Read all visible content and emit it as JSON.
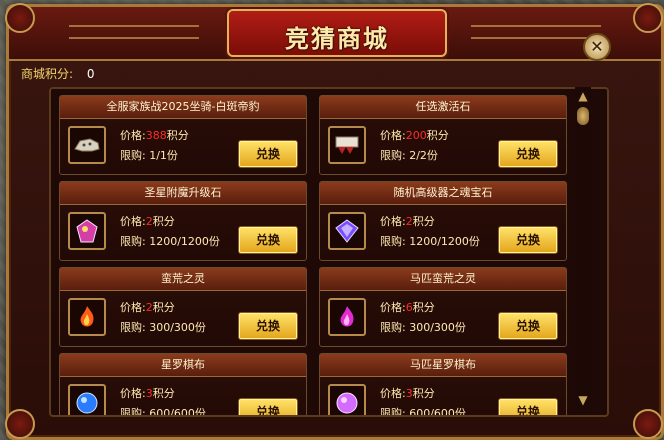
{
  "window": {
    "title": "竞猜商城",
    "close_icon": "close-icon"
  },
  "points": {
    "label": "商城积分:",
    "value": "0"
  },
  "labels": {
    "price_prefix": "价格:",
    "unit": "积分",
    "limit_prefix": "限购:",
    "exchange": "兑换"
  },
  "items": [
    {
      "name": "全服家族战2025坐骑-白斑帝豹",
      "price": "388",
      "limit": "1/1份",
      "icon": "leopard-mount-icon"
    },
    {
      "name": "任选激活石",
      "price": "200",
      "limit": "2/2份",
      "icon": "activation-stone-icon"
    },
    {
      "name": "圣星附魔升级石",
      "price": "2",
      "limit": "1200/1200份",
      "icon": "enchant-stone-icon"
    },
    {
      "name": "随机高级器之魂宝石",
      "price": "2",
      "limit": "1200/1200份",
      "icon": "soul-gem-icon"
    },
    {
      "name": "蛮荒之灵",
      "price": "2",
      "limit": "300/300份",
      "icon": "fire-spirit-icon"
    },
    {
      "name": "马匹蛮荒之灵",
      "price": "6",
      "limit": "300/300份",
      "icon": "horse-spirit-icon"
    },
    {
      "name": "星罗棋布",
      "price": "3",
      "limit": "600/600份",
      "icon": "blue-orb-icon"
    },
    {
      "name": "马匹星罗棋布",
      "price": "3",
      "limit": "600/600份",
      "icon": "pink-orb-icon"
    }
  ],
  "colors": {
    "price": "#ff2b2b",
    "button": "#f0c23a",
    "title_plate": "#b11d15"
  }
}
